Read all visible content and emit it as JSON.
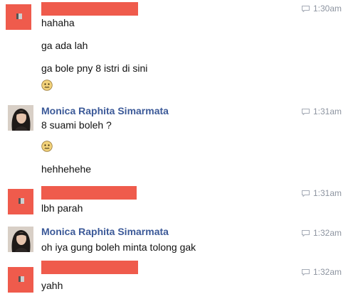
{
  "colors": {
    "redacted": "#ef5b4c",
    "sender_name": "#3b5998",
    "timestamp": "#8d94a0"
  },
  "messages": [
    {
      "sender": "",
      "time": "1:30am",
      "avatar": "redacted",
      "lines": [
        "hahaha",
        "ga ada lah",
        "ga bole pny 8 istri di sini",
        ":emoji-confused:"
      ]
    },
    {
      "sender": "Monica Raphita Simarmata",
      "time": "1:31am",
      "avatar": "photo",
      "lines": [
        "8 suami boleh ?",
        ":emoji-confused:",
        "hehhehehe"
      ]
    },
    {
      "sender": "",
      "time": "1:31am",
      "avatar": "redacted",
      "lines": [
        "lbh parah"
      ]
    },
    {
      "sender": "Monica Raphita Simarmata",
      "time": "1:32am",
      "avatar": "photo",
      "lines": [
        "oh iya gung boleh minta tolong gak"
      ]
    },
    {
      "sender": "",
      "time": "1:32am",
      "avatar": "redacted",
      "lines": [
        "yahh"
      ]
    }
  ]
}
